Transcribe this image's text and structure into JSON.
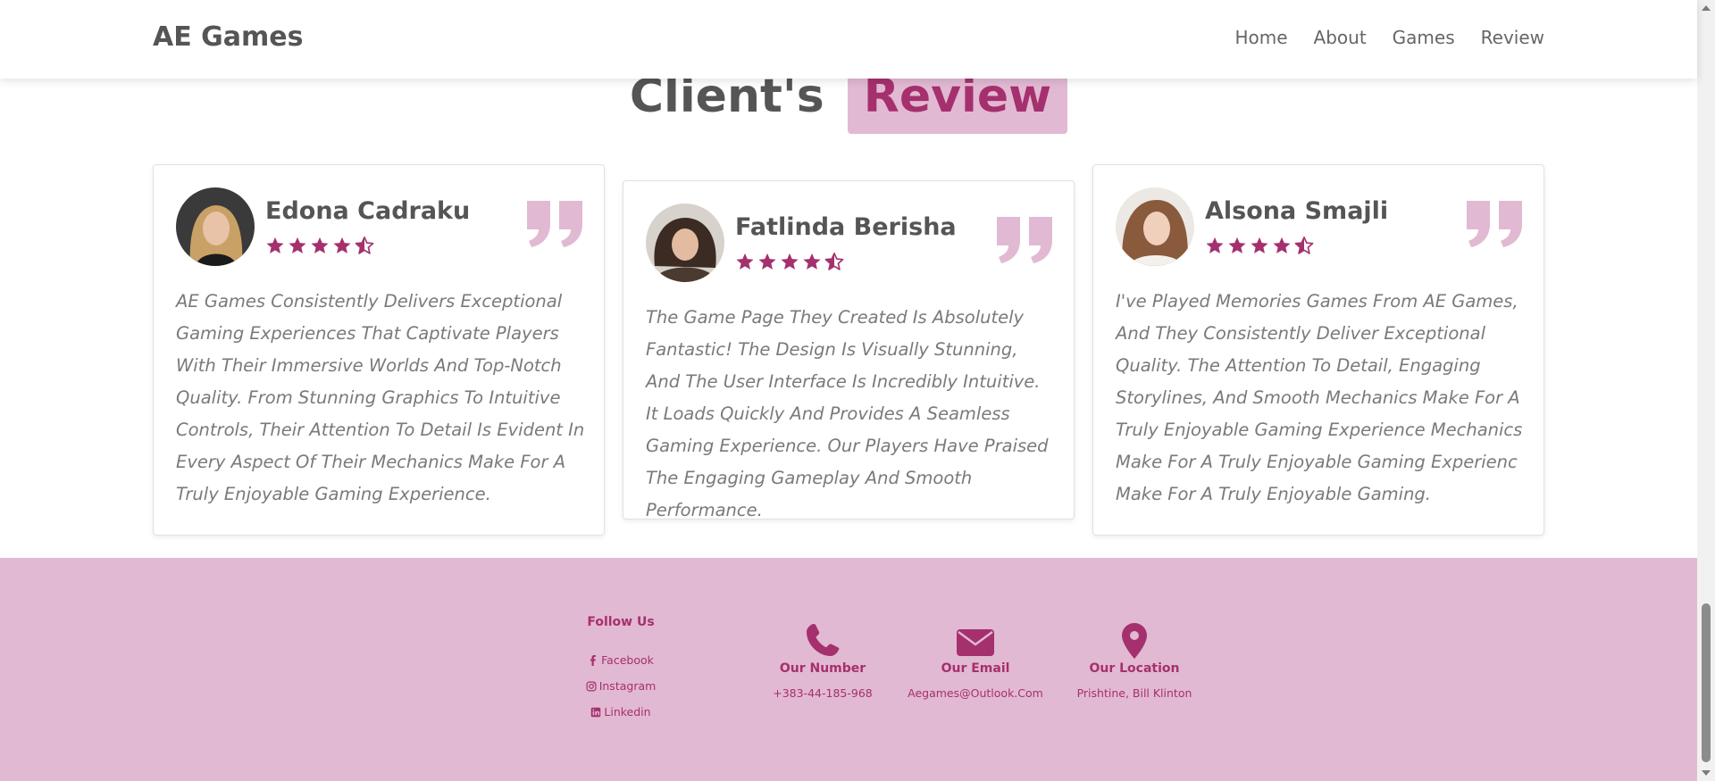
{
  "brand": "AE Games",
  "nav": [
    "Home",
    "About",
    "Games",
    "Review"
  ],
  "section": {
    "title_main": "Client's",
    "title_highlight": "Review"
  },
  "reviews": [
    {
      "name": "Edona Cadraku",
      "rating": 4.5,
      "text": "AE Games Consistently Delivers Exceptional Gaming Experiences That Captivate Players With Their Immersive Worlds And Top-Notch Quality. From Stunning Graphics To Intuitive Controls, Their Attention To Detail Is Evident In Every Aspect Of Their Mechanics Make For A Truly Enjoyable Gaming Experience."
    },
    {
      "name": "Fatlinda Berisha",
      "rating": 4.5,
      "text": "The Game Page They Created Is Absolutely Fantastic! The Design Is Visually Stunning, And The User Interface Is Incredibly Intuitive. It Loads Quickly And Provides A Seamless Gaming Experience. Our Players Have Praised The Engaging Gameplay And Smooth Performance."
    },
    {
      "name": "Alsona Smajli",
      "rating": 4.5,
      "text": "I've Played Memories Games From AE Games, And They Consistently Deliver Exceptional Quality. The Attention To Detail, Engaging Storylines, And Smooth Mechanics Make For A Truly Enjoyable Gaming Experience Mechanics Make For A Truly Enjoyable Gaming Experienc Make For A Truly Enjoyable Gaming."
    }
  ],
  "footer": {
    "follow_title": "Follow Us",
    "social": [
      "Facebook",
      "Instagram",
      "Linkedin"
    ],
    "contacts": [
      {
        "icon": "phone-icon",
        "title": "Our Number",
        "value": "+383-44-185-968"
      },
      {
        "icon": "envelope-icon",
        "title": "Our Email",
        "value": "Aegames@Outlook.Com"
      },
      {
        "icon": "location-pin-icon",
        "title": "Our Location",
        "value": "Prishtine, Bill Klinton"
      }
    ]
  },
  "colors": {
    "accent": "#a5306e",
    "accent_light": "#e2b9d2",
    "text": "#555555",
    "muted": "#7a7a7a"
  }
}
